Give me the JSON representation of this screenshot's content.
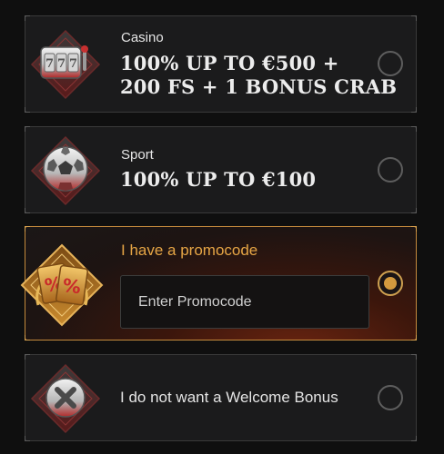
{
  "options": {
    "casino": {
      "kicker": "Casino",
      "line1": "100% UP TO €500 +",
      "line2": "200 FS + 1 BONUS CRAB",
      "icon": "slot-machine-icon",
      "selected": false
    },
    "sport": {
      "kicker": "Sport",
      "line1": "100% UP TO €100",
      "icon": "soccer-ball-icon",
      "selected": false
    },
    "promo": {
      "kicker": "I have a promocode",
      "placeholder": "Enter Promocode",
      "value": "",
      "icon": "percent-ticket-icon",
      "selected": true
    },
    "none": {
      "label": "I do not want a Welcome Bonus",
      "icon": "x-mark-icon",
      "selected": false
    }
  },
  "colors": {
    "background": "#0f0f0f",
    "card": "#1b1b1c",
    "accent": "#d39a3e",
    "promo_text": "#e6a545"
  }
}
